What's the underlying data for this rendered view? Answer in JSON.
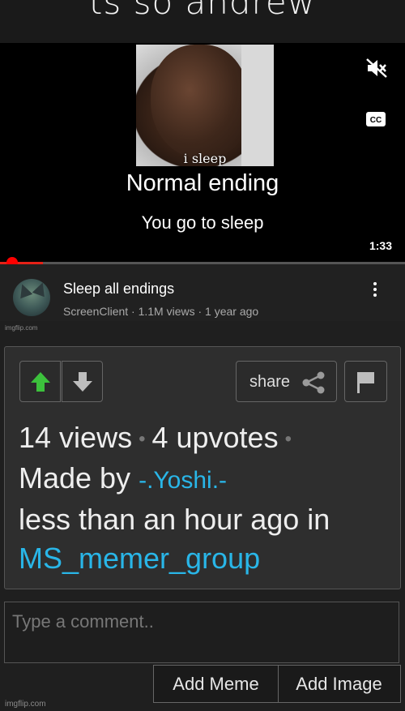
{
  "top_caption": "ts so andrew",
  "video": {
    "meme_caption": "i sleep",
    "line1": "Normal ending",
    "line2": "You go to sleep",
    "duration": "1:33",
    "progress_fraction": 0.015,
    "accent_color": "#ff0000",
    "icons": [
      "mute-icon",
      "closed-captions-icon"
    ]
  },
  "info": {
    "title": "Sleep all endings",
    "meta": "ScreenClient · 1.1M views · 1 year ago"
  },
  "watermark": "imgflip.com",
  "card": {
    "share_label": "share",
    "views": "14 views",
    "upvotes": "4 upvotes",
    "made_by_prefix": "Made by",
    "author": "-.Yoshi.-",
    "time_text": "less than an hour ago in",
    "stream": "MS_memer_group",
    "link_color": "#29b6e8",
    "upvote_color": "#3cc13c"
  },
  "comment": {
    "placeholder": "Type a comment..",
    "add_meme_label": "Add Meme",
    "add_image_label": "Add Image"
  }
}
